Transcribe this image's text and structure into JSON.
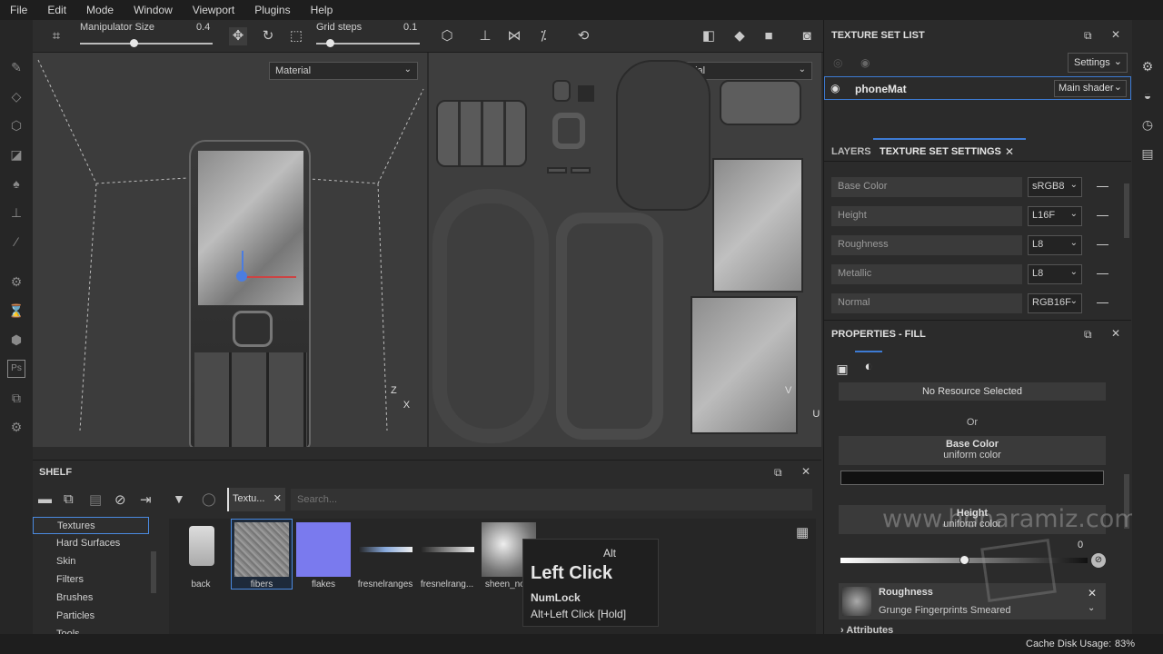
{
  "menu": [
    "File",
    "Edit",
    "Mode",
    "Window",
    "Viewport",
    "Plugins",
    "Help"
  ],
  "toolbar": {
    "manipulator_label": "Manipulator Size",
    "manipulator_value": "0.4",
    "grid_label": "Grid steps",
    "grid_value": "0.1"
  },
  "viewport3d": {
    "mode": "Material",
    "axis_y": "Z",
    "axis_x": "X"
  },
  "viewport2d": {
    "mode": "Material",
    "axis_y": "V",
    "axis_x": "U"
  },
  "shelf": {
    "title": "SHELF",
    "filter_tag": "Textu...",
    "search_placeholder": "Search...",
    "categories": [
      "Textures",
      "Hard Surfaces",
      "Skin",
      "Filters",
      "Brushes",
      "Particles",
      "Tools"
    ],
    "items": [
      {
        "label": "back"
      },
      {
        "label": "fibers"
      },
      {
        "label": "flakes"
      },
      {
        "label": "fresnelranges"
      },
      {
        "label": "fresnelrang..."
      },
      {
        "label": "sheen_no..."
      }
    ]
  },
  "tooltip": {
    "modifier": "Alt",
    "action": "Left Click",
    "key": "NumLock",
    "combo": "Alt+Left Click [Hold]"
  },
  "texture_set_list": {
    "title": "TEXTURE SET LIST",
    "settings_label": "Settings",
    "material_name": "phoneMat",
    "shader_label": "Main shader"
  },
  "tabs": {
    "layers": "LAYERS",
    "settings": "TEXTURE SET SETTINGS"
  },
  "channels": [
    {
      "name": "Base Color",
      "format": "sRGB8"
    },
    {
      "name": "Height",
      "format": "L16F"
    },
    {
      "name": "Roughness",
      "format": "L8"
    },
    {
      "name": "Metallic",
      "format": "L8"
    },
    {
      "name": "Normal",
      "format": "RGB16F"
    }
  ],
  "properties": {
    "title": "PROPERTIES - FILL",
    "no_resource": "No Resource Selected",
    "or_label": "Or",
    "base_color_title": "Base Color",
    "base_color_sub": "uniform color",
    "height_title": "Height",
    "height_sub": "uniform color",
    "height_value": "0",
    "roughness_title": "Roughness",
    "roughness_resource": "Grunge Fingerprints Smeared",
    "attributes_label": "Attributes"
  },
  "status": {
    "cache_label": "Cache Disk Usage:",
    "cache_value": "83%"
  },
  "watermark": "www.honaramiz.com",
  "colors": {
    "accent": "#3d7bd4",
    "panel": "#2b2b2b",
    "menubar": "#1e1e1e"
  }
}
